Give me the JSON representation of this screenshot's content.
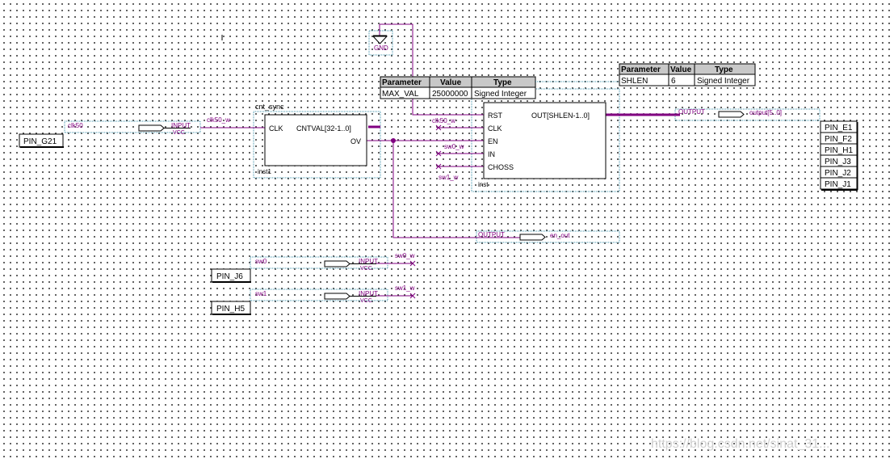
{
  "gnd": {
    "label": "GND"
  },
  "cnt_sync": {
    "name": "cnt_sync",
    "instance": "inst1",
    "ports": {
      "clk": "CLK",
      "cntval": "CNTVAL[32-1..0]",
      "ov": "OV"
    }
  },
  "shift": {
    "instance": "inst",
    "ports": {
      "rst": "RST",
      "clk": "CLK",
      "en": "EN",
      "in": "IN",
      "choss": "CHOSS",
      "out": "OUT[SHLEN-1..0]"
    }
  },
  "param_table_1": {
    "headers": [
      "Parameter",
      "Value",
      "Type"
    ],
    "rows": [
      [
        "MAX_VAL",
        "25000000",
        "Signed Integer"
      ]
    ]
  },
  "param_table_2": {
    "headers": [
      "Parameter",
      "Value",
      "Type"
    ],
    "rows": [
      [
        "SHLEN",
        "6",
        "Signed Integer"
      ]
    ]
  },
  "inputs": {
    "clk50": {
      "net": "clk50",
      "dir": "INPUT",
      "vcc": "VCC",
      "pin": "PIN_G21"
    },
    "sw0": {
      "net": "sw0",
      "dir": "INPUT",
      "vcc": "VCC",
      "pin": "PIN_J6"
    },
    "sw1": {
      "net": "sw1",
      "dir": "INPUT",
      "vcc": "VCC",
      "pin": "PIN_H5"
    }
  },
  "outputs": {
    "output": {
      "dir": "OUTPUT",
      "net": "output[5..0]",
      "pins": [
        "PIN_E1",
        "PIN_F2",
        "PIN_H1",
        "PIN_J3",
        "PIN_J2",
        "PIN_J1"
      ]
    },
    "en_out": {
      "dir": "OUTPUT",
      "net": "en_out"
    }
  },
  "wires": {
    "clk50_w": "clk50_w",
    "sw0_w": "sw0_w",
    "sw1_w": "sw1_w"
  },
  "watermark": "https://blog.csdn.net/sinat_31..."
}
